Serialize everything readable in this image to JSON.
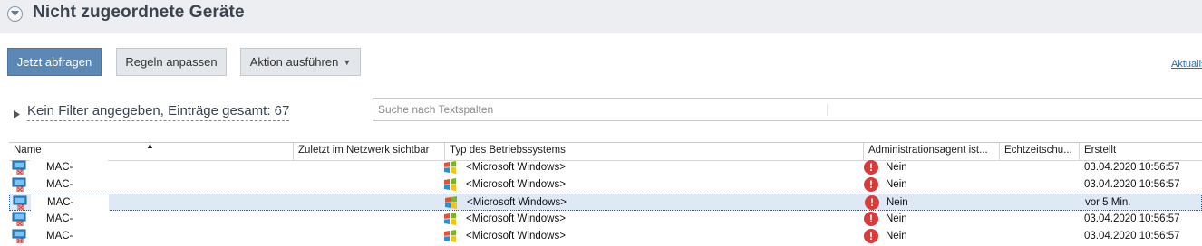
{
  "header": {
    "title": "Nicht zugeordnete Geräte"
  },
  "toolbar": {
    "query_label": "Jetzt abfragen",
    "rules_label": "Regeln anpassen",
    "action_label": "Aktion ausführen",
    "refresh_label": "Aktualisieren"
  },
  "filter": {
    "summary": "Kein Filter angegeben, Einträge gesamt: 67"
  },
  "search": {
    "placeholder": "Suche nach Textspalten"
  },
  "table": {
    "columns": [
      "Name",
      "Zuletzt im Netzwerk sichtbar",
      "Typ des Betriebssystems",
      "Administrationsagent ist...",
      "Echtzeitschu...",
      "Erstellt"
    ],
    "sorted_column": "Name",
    "rows": [
      {
        "name": "MAC-",
        "last_seen": "",
        "os": "<Microsoft Windows>",
        "agent": "Nein",
        "created": "03.04.2020 10:56:57",
        "selected": false
      },
      {
        "name": "MAC-",
        "last_seen": "",
        "os": "<Microsoft Windows>",
        "agent": "Nein",
        "created": "03.04.2020 10:56:57",
        "selected": false
      },
      {
        "name": "MAC-",
        "last_seen": "",
        "os": "<Microsoft Windows>",
        "agent": "Nein",
        "created": "vor 5 Min.",
        "selected": true
      },
      {
        "name": "MAC-",
        "last_seen": "",
        "os": "<Microsoft Windows>",
        "agent": "Nein",
        "created": "03.04.2020 10:56:57",
        "selected": false
      },
      {
        "name": "MAC-",
        "last_seen": "",
        "os": "<Microsoft Windows>",
        "agent": "Nein",
        "created": "03.04.2020 10:56:57",
        "selected": false
      }
    ]
  },
  "icons": {
    "collapse": "chevron-down-icon",
    "filter_toggle": "triangle-right-icon",
    "device": "computer-unassigned-icon",
    "os": "windows-logo-icon",
    "agent_status": "error-exclamation-icon"
  },
  "colors": {
    "primary_button": "#5b88b5",
    "link": "#2a6bb0",
    "warning": "#d93a3a",
    "selection": "#dfe8f5"
  }
}
